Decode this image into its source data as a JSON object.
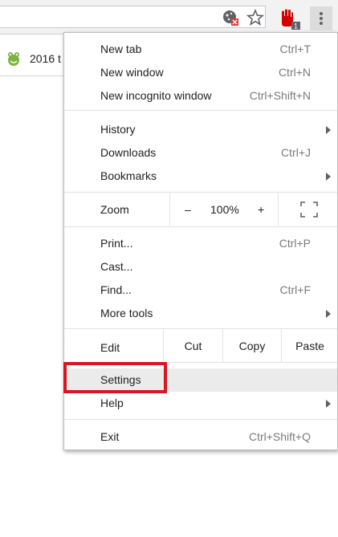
{
  "bookmark": {
    "label": "2016 t"
  },
  "toolbar": {
    "icons": [
      "cookie-blocked-icon",
      "star-icon",
      "adblock-icon",
      "menu-dots-icon"
    ],
    "adblock_badge": "1"
  },
  "menu": {
    "new_tab": {
      "label": "New tab",
      "shortcut": "Ctrl+T"
    },
    "new_window": {
      "label": "New window",
      "shortcut": "Ctrl+N"
    },
    "incognito": {
      "label": "New incognito window",
      "shortcut": "Ctrl+Shift+N"
    },
    "history": {
      "label": "History"
    },
    "downloads": {
      "label": "Downloads",
      "shortcut": "Ctrl+J"
    },
    "bookmarks": {
      "label": "Bookmarks"
    },
    "zoom": {
      "label": "Zoom",
      "minus": "–",
      "value": "100%",
      "plus": "+"
    },
    "print": {
      "label": "Print...",
      "shortcut": "Ctrl+P"
    },
    "cast": {
      "label": "Cast..."
    },
    "find": {
      "label": "Find...",
      "shortcut": "Ctrl+F"
    },
    "more_tools": {
      "label": "More tools"
    },
    "edit": {
      "label": "Edit",
      "cut": "Cut",
      "copy": "Copy",
      "paste": "Paste"
    },
    "settings": {
      "label": "Settings"
    },
    "help": {
      "label": "Help"
    },
    "exit": {
      "label": "Exit",
      "shortcut": "Ctrl+Shift+Q"
    }
  },
  "colors": {
    "highlight_border": "#d7161f",
    "hover_bg": "#ebebeb"
  }
}
